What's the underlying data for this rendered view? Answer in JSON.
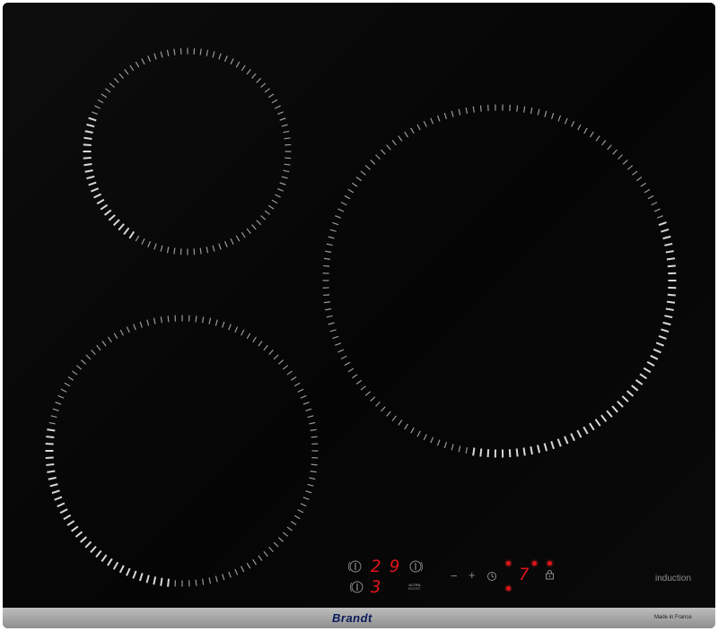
{
  "hob": {
    "zones": [
      {
        "name": "rear-left-zone",
        "level": 0
      },
      {
        "name": "front-left-zone",
        "level": 3
      },
      {
        "name": "right-zone",
        "level": 9
      }
    ],
    "displays": {
      "top_left_digit": "2",
      "top_right_digit": "9",
      "bottom_digit": "3",
      "timer_digit": "7"
    },
    "controls": {
      "minus": "−",
      "plus": "+",
      "boost_line1": "ULTRA",
      "boost_line2": "BOOST"
    },
    "labels": {
      "induction": "induction",
      "brand": "Brandt",
      "made_in": "Made in France"
    },
    "icons": [
      "power-icon",
      "power-icon",
      "power-icon",
      "timer-icon",
      "lock-icon"
    ],
    "colors": {
      "glass": "#070707",
      "display": "#e0131b",
      "frame": "#a8a8a8",
      "brand": "#0a1a5a"
    }
  }
}
